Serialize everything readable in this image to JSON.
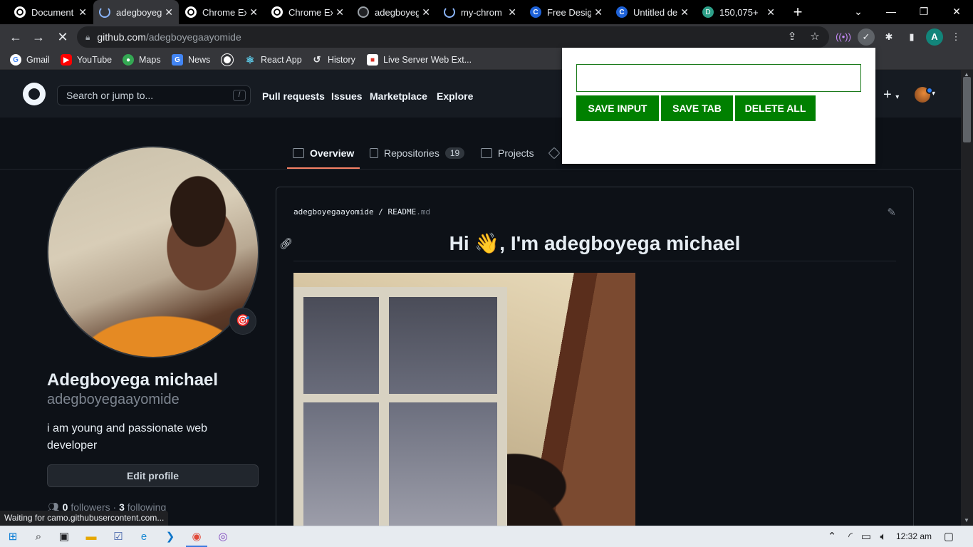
{
  "browser": {
    "tabs": [
      {
        "title": "Document",
        "favicon": "globe-icon"
      },
      {
        "title": "adegboyega",
        "favicon": "loading-spinner-icon"
      },
      {
        "title": "Chrome Ex",
        "favicon": "globe-icon"
      },
      {
        "title": "Chrome Ex",
        "favicon": "globe-icon"
      },
      {
        "title": "adegboyeg",
        "favicon": "github-icon"
      },
      {
        "title": "my-chrom",
        "favicon": "loading-spinner-icon"
      },
      {
        "title": "Free Desig",
        "favicon": "canva-icon"
      },
      {
        "title": "Untitled de",
        "favicon": "canva-icon"
      },
      {
        "title": "150,075+",
        "favicon": "d-icon"
      }
    ],
    "address": {
      "host": "github.com",
      "path": "/adegboyegaayomide"
    },
    "profile_initial": "A",
    "bookmarks": [
      "Gmail",
      "YouTube",
      "Maps",
      "News",
      "React App",
      "History",
      "Live Server Web Ext..."
    ],
    "status_text": "Waiting for camo.githubusercontent.com..."
  },
  "github": {
    "search_placeholder": "Search or jump to...",
    "search_shortcut": "/",
    "nav": [
      "Pull requests",
      "Issues",
      "Marketplace",
      "Explore"
    ],
    "profile_tabs": [
      {
        "label": "Overview",
        "selected": true
      },
      {
        "label": "Repositories",
        "count": "19"
      },
      {
        "label": "Projects"
      }
    ],
    "profile": {
      "full_name": "Adegboyega michael",
      "username": "adegboyegaayomide",
      "bio": "i am young and passionate web developer",
      "edit_button": "Edit profile",
      "followers_count": "0",
      "followers_label": "followers",
      "separator": "·",
      "following_count": "3",
      "following_label": "following"
    },
    "readme": {
      "owner": "adegboyegaayomide",
      "file": "README",
      "ext": ".md",
      "heading": "Hi 👋, I'm adegboyega michael"
    }
  },
  "popup": {
    "input_value": "",
    "buttons": [
      "SAVE INPUT",
      "SAVE TAB",
      "DELETE ALL"
    ],
    "button_color": "#008000"
  },
  "taskbar": {
    "time": "12:32 am"
  }
}
